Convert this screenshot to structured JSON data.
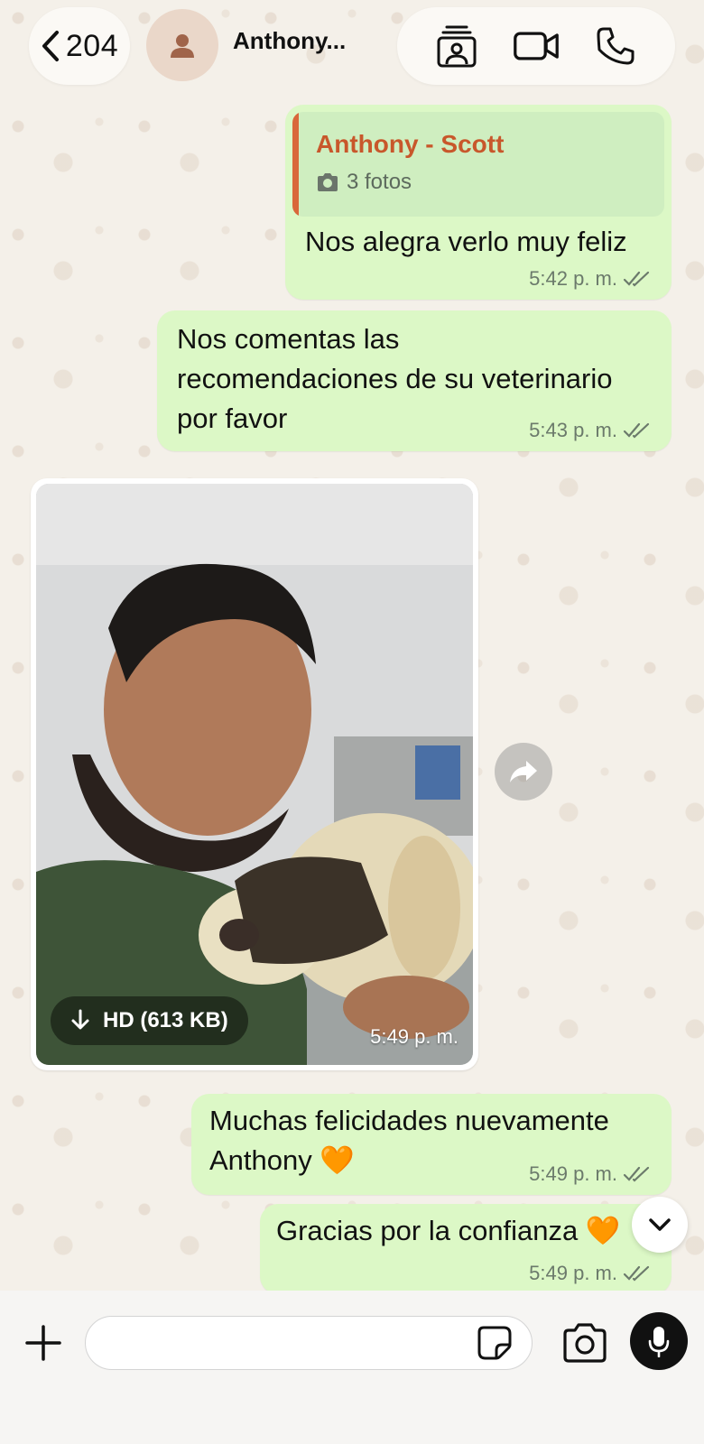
{
  "header": {
    "back_count": "204",
    "contact_name": "Anthony...",
    "icons": [
      "chevron-left-icon",
      "avatar-person-icon",
      "contact-card-icon",
      "video-call-icon",
      "phone-icon"
    ]
  },
  "messages": [
    {
      "quote": {
        "author": "Anthony - Scott",
        "subtitle": "3 fotos"
      },
      "text": "Nos alegra verlo muy feliz",
      "time": "5:42 p. m."
    },
    {
      "lines": [
        "Nos comentas las",
        "recomendaciones de su veterinario",
        "por favor"
      ],
      "time": "5:43 p. m."
    },
    {
      "photo": {
        "hd_label": "HD (613 KB)",
        "time": "5:49 p. m."
      }
    },
    {
      "lines": [
        "Muchas felicidades nuevamente",
        "Anthony 🧡"
      ],
      "time": "5:49 p. m."
    },
    {
      "text": "Gracias por la confianza 🧡",
      "time": "5:49 p. m."
    }
  ],
  "composer": {
    "placeholder": ""
  },
  "colors": {
    "outgoing_bubble": "#dcf8c6",
    "quote_author": "#c8572b",
    "wallpaper": "#f4f0e9"
  }
}
